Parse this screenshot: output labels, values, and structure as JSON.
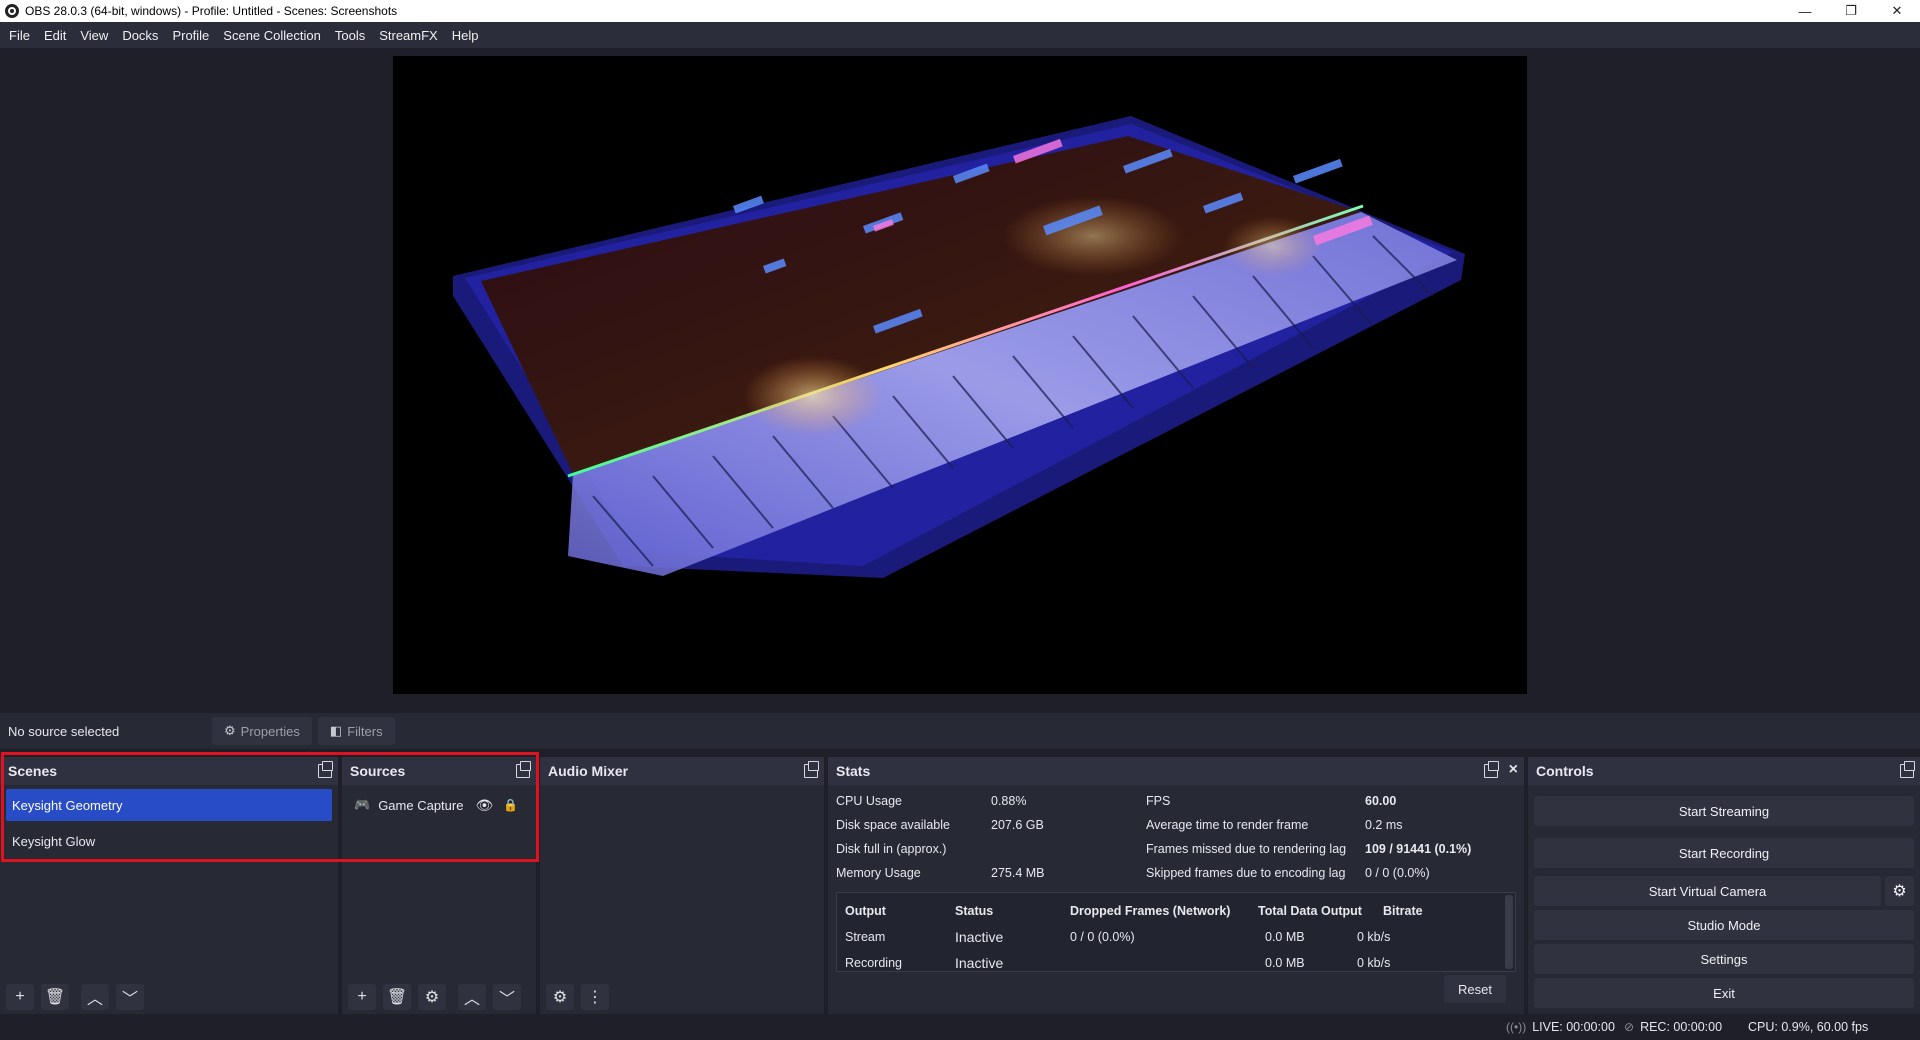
{
  "window": {
    "title": "OBS 28.0.3 (64-bit, windows) - Profile: Untitled - Scenes: Screenshots",
    "minimize": "—",
    "maximize": "❐",
    "close": "✕"
  },
  "menu": [
    "File",
    "Edit",
    "View",
    "Docks",
    "Profile",
    "Scene Collection",
    "Tools",
    "StreamFX",
    "Help"
  ],
  "context": {
    "no_source": "No source selected",
    "properties": "Properties",
    "filters": "Filters"
  },
  "scenes": {
    "title": "Scenes",
    "items": [
      "Keysight Geometry",
      "Keysight Glow"
    ]
  },
  "sources": {
    "title": "Sources",
    "items": [
      {
        "name": "Game Capture"
      }
    ]
  },
  "audio_mixer": {
    "title": "Audio Mixer"
  },
  "stats": {
    "title": "Stats",
    "left": [
      {
        "label": "CPU Usage",
        "value": "0.88%"
      },
      {
        "label": "Disk space available",
        "value": "207.6 GB"
      },
      {
        "label": "Disk full in (approx.)",
        "value": ""
      },
      {
        "label": "Memory Usage",
        "value": "275.4 MB"
      }
    ],
    "right": [
      {
        "label": "FPS",
        "value": "60.00"
      },
      {
        "label": "Average time to render frame",
        "value": "0.2 ms"
      },
      {
        "label": "Frames missed due to rendering lag",
        "value": "109 / 91441 (0.1%)"
      },
      {
        "label": "Skipped frames due to encoding lag",
        "value": "0 / 0 (0.0%)"
      }
    ],
    "table": {
      "headers": [
        "Output",
        "Status",
        "Dropped Frames (Network)",
        "Total Data Output",
        "Bitrate"
      ],
      "rows": [
        [
          "Stream",
          "Inactive",
          "0 / 0 (0.0%)",
          "0.0 MB",
          "0 kb/s"
        ],
        [
          "Recording",
          "Inactive",
          "",
          "0.0 MB",
          "0 kb/s"
        ]
      ]
    },
    "reset": "Reset"
  },
  "controls": {
    "title": "Controls",
    "start_streaming": "Start Streaming",
    "start_recording": "Start Recording",
    "start_virtual_camera": "Start Virtual Camera",
    "studio_mode": "Studio Mode",
    "settings": "Settings",
    "exit": "Exit"
  },
  "status": {
    "live": "LIVE: 00:00:00",
    "rec": "REC: 00:00:00",
    "cpu": "CPU: 0.9%, 60.00 fps"
  },
  "colors": {
    "accent": "#284bc6",
    "highlight": "#e0121f"
  }
}
